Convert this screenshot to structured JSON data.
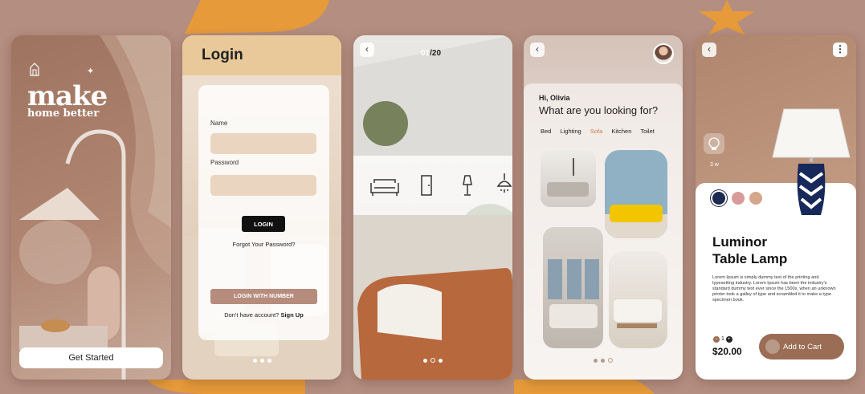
{
  "palette": {
    "background": "#b48e80",
    "accent_orange": "#e69a3a",
    "brown_button": "#9b6d55",
    "swatch_navy": "#1d2a52",
    "swatch_pink": "#d99a9a",
    "swatch_tan": "#d4a78a"
  },
  "screen1": {
    "title_main": "make",
    "title_sub": "home better",
    "cta_label": "Get Started",
    "logo_icon": "house-icon"
  },
  "screen2": {
    "title": "Login",
    "name_label": "Name",
    "password_label": "Password",
    "login_button": "LOGIN",
    "forgot_link": "Forgot Your Password?",
    "login_number_button": "LOGIN WITH NUMBER",
    "no_account_text": "Don't have account?",
    "sign_up_link": "Sign Up"
  },
  "screen3": {
    "current": "01",
    "total": "/20",
    "icons": [
      "sofa-icon",
      "door-icon",
      "lamp-icon",
      "ceiling-lamp-icon"
    ]
  },
  "screen4": {
    "greeting": "Hi, Olivia",
    "question": "What are you looking for?",
    "categories": [
      "Bed",
      "Lighting",
      "Sofa",
      "Kitchen",
      "Toilet"
    ],
    "active_category": "Sofa"
  },
  "screen5": {
    "wattage": "3 w",
    "product_name_line1": "Luminor",
    "product_name_line2": "Table Lamp",
    "description": "Lorem Ipsum is simply dummy text of the printing and typesetting industry. Lorem Ipsum has been the industry's standard dummy text ever since the 1500s, when an unknown printer took a galley of type and scrambled it to make a type specimen book.",
    "quantity": "1",
    "price": "$20.00",
    "add_to_cart": "Add to Cart",
    "more_icon": "⋮"
  }
}
